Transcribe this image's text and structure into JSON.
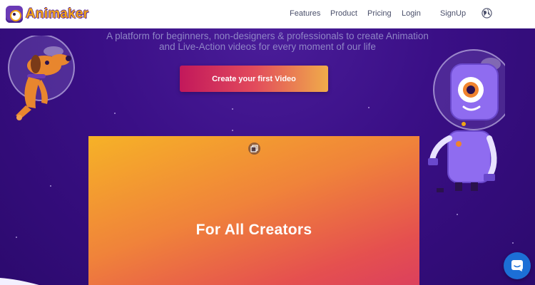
{
  "brand": {
    "name": "Animaker"
  },
  "nav": {
    "items": [
      {
        "label": "Features"
      },
      {
        "label": "Product"
      },
      {
        "label": "Pricing"
      },
      {
        "label": "Login"
      },
      {
        "label": "SignUp"
      }
    ],
    "language_icon": "globe-icon"
  },
  "hero": {
    "subtitle_line1": "A platform for beginners, non-designers & professionals to create Animation",
    "subtitle_line2": "and Live-Action videos for every moment of our life",
    "cta_label": "Create your first Video",
    "video_card_title": "For All Creators",
    "video_card_icon": "expand-icon"
  },
  "colors": {
    "brand_purple": "#3a0f86",
    "logo_orange": "#f2a516",
    "cta_gradient_start": "#c2185b",
    "cta_gradient_end": "#f0ac4a",
    "chat_blue": "#1c6fd6"
  },
  "chat": {
    "icon": "chat-icon"
  }
}
